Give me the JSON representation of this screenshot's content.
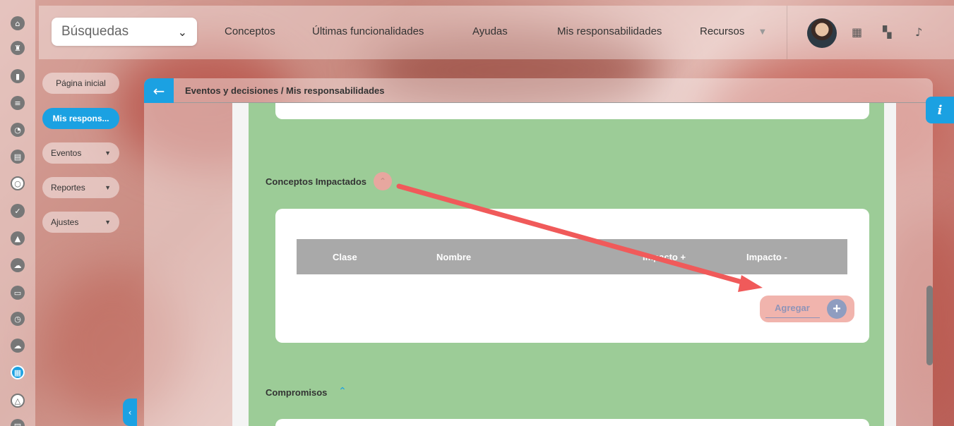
{
  "topbar": {
    "search_select": "Búsquedas",
    "nav": [
      "Conceptos",
      "Últimas funcionalidades",
      "Ayudas",
      "Mis responsabilidades",
      "Recursos"
    ],
    "icons": [
      "calendar-icon",
      "map-icon",
      "bell-icon"
    ]
  },
  "rail": {
    "icons": [
      "home-icon",
      "chess-rook-icon",
      "bar-chart-icon",
      "list-icon",
      "pie-chart-icon",
      "document-icon",
      "circle-sync-icon",
      "check-circle-icon",
      "warning-icon",
      "cloud-users-icon",
      "monitor-icon",
      "clock-icon",
      "cloud-icon",
      "calendar-icon",
      "network-icon",
      "list-small-icon"
    ]
  },
  "sidebar": {
    "items": [
      {
        "label": "Página inicial"
      },
      {
        "label": "Mis respons..."
      },
      {
        "label": "Eventos"
      },
      {
        "label": "Reportes"
      },
      {
        "label": "Ajustes"
      }
    ]
  },
  "panel": {
    "breadcrumb": "Eventos y decisiones / Mis responsabilidades"
  },
  "sections": {
    "impactados_title": "Conceptos Impactados",
    "table_headers": [
      "Clase",
      "Nombre",
      "Impacto +",
      "Impacto -"
    ],
    "add_label": "Agregar",
    "compromisos_title": "Compromisos"
  },
  "colors": {
    "accent": "#1ba1e2",
    "green_bg": "#9ccc97",
    "table_header": "#a9a9a9",
    "arrow": "#f05a5a"
  }
}
